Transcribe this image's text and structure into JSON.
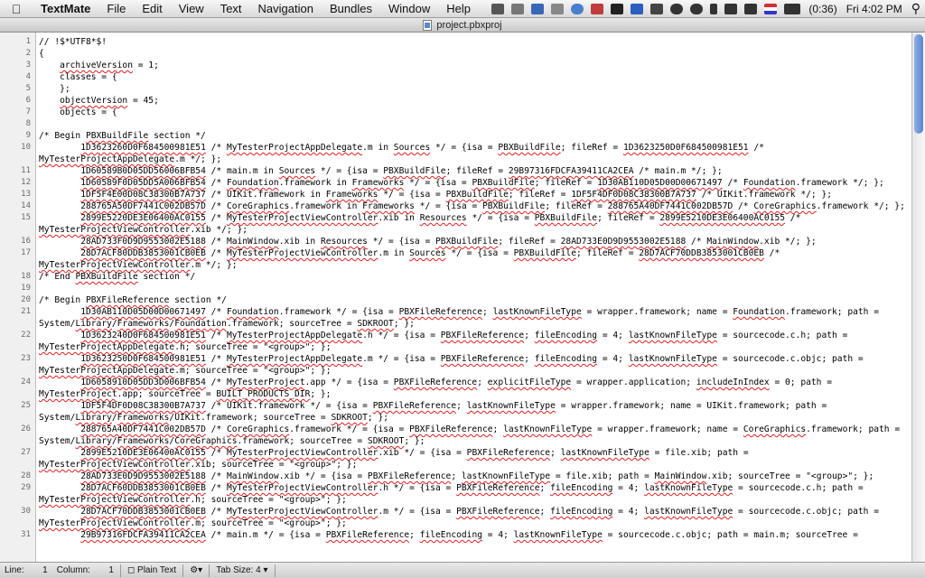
{
  "menubar": {
    "app": "TextMate",
    "items": [
      "File",
      "Edit",
      "View",
      "Text",
      "Navigation",
      "Bundles",
      "Window",
      "Help"
    ],
    "battery": "(0:36)",
    "clock": "Fri 4:02 PM"
  },
  "window": {
    "title": "project.pbxproj"
  },
  "status": {
    "line_label": "Line:",
    "line": "1",
    "column_label": "Column:",
    "column": "1",
    "language": "Plain Text",
    "tab_size_label": "Tab Size:",
    "tab_size": "4"
  },
  "line_numbers": [
    "1",
    "2",
    "3",
    "4",
    "5",
    "6",
    "7",
    "8",
    "9",
    "10",
    "11",
    "12",
    "13",
    "14",
    "15",
    "16",
    "17",
    "18",
    "19",
    "20",
    "21",
    "22",
    "23",
    "24",
    "25",
    "26",
    "27",
    "28",
    "29",
    "30",
    "31"
  ],
  "rows": [
    {
      "ln": "1",
      "t": "// !$*UTF8*$!"
    },
    {
      "ln": "2",
      "t": "{"
    },
    {
      "ln": "3",
      "t": "\tarchiveVersion = 1;"
    },
    {
      "ln": "4",
      "t": "\tclasses = {"
    },
    {
      "ln": "5",
      "t": "\t};"
    },
    {
      "ln": "6",
      "t": "\tobjectVersion = 45;"
    },
    {
      "ln": "7",
      "t": "\tobjects = {"
    },
    {
      "ln": "8",
      "t": ""
    },
    {
      "ln": "9",
      "t": "/* Begin PBXBuildFile section */"
    },
    {
      "ln": "10",
      "t": "\t\t1D3623260D0F684500981E51 /* MyTesterProjectAppDelegate.m in Sources */ = {isa = PBXBuildFile; fileRef = 1D3623250D0F684500981E51 /*"
    },
    {
      "ln": "",
      "t": "MyTesterProjectAppDelegate.m */; };"
    },
    {
      "ln": "11",
      "t": "\t\t1D60589B0D05DD56006BFB54 /* main.m in Sources */ = {isa = PBXBuildFile; fileRef = 29B97316FDCFA39411CA2CEA /* main.m */; };"
    },
    {
      "ln": "12",
      "t": "\t\t1D60589F0D05DD5A006BFB54 /* Foundation.framework in Frameworks */ = {isa = PBXBuildFile; fileRef = 1D30AB110D05D00D00671497 /* Foundation.framework */; };"
    },
    {
      "ln": "13",
      "t": "\t\t1DF5F4E00D08C38300B7A737 /* UIKit.framework in Frameworks */ = {isa = PBXBuildFile; fileRef = 1DF5F4DF0D08C38300B7A737 /* UIKit.framework */; };"
    },
    {
      "ln": "14",
      "t": "\t\t288765A50DF7441C002DB57D /* CoreGraphics.framework in Frameworks */ = {isa = PBXBuildFile; fileRef = 288765A40DF7441C002DB57D /* CoreGraphics.framework */; };"
    },
    {
      "ln": "15",
      "t": "\t\t2899E5220DE3E06400AC0155 /* MyTesterProjectViewController.xib in Resources */ = {isa = PBXBuildFile; fileRef = 2899E5210DE3E06400AC0155 /*"
    },
    {
      "ln": "",
      "t": "MyTesterProjectViewController.xib */; };"
    },
    {
      "ln": "16",
      "t": "\t\t28AD733F0D9D9553002E5188 /* MainWindow.xib in Resources */ = {isa = PBXBuildFile; fileRef = 28AD733E0D9D9553002E5188 /* MainWindow.xib */; };"
    },
    {
      "ln": "17",
      "t": "\t\t28D7ACF80DDB3853001CB0EB /* MyTesterProjectViewController.m in Sources */ = {isa = PBXBuildFile; fileRef = 28D7ACF70DDB3853001CB0EB /*"
    },
    {
      "ln": "",
      "t": "MyTesterProjectViewController.m */; };"
    },
    {
      "ln": "18",
      "t": "/* End PBXBuildFile section */"
    },
    {
      "ln": "19",
      "t": ""
    },
    {
      "ln": "20",
      "t": "/* Begin PBXFileReference section */"
    },
    {
      "ln": "21",
      "t": "\t\t1D30AB110D05D00D00671497 /* Foundation.framework */ = {isa = PBXFileReference; lastKnownFileType = wrapper.framework; name = Foundation.framework; path ="
    },
    {
      "ln": "",
      "t": "System/Library/Frameworks/Foundation.framework; sourceTree = SDKROOT; };"
    },
    {
      "ln": "22",
      "t": "\t\t1D3623240D0F684500981E51 /* MyTesterProjectAppDelegate.h */ = {isa = PBXFileReference; fileEncoding = 4; lastKnownFileType = sourcecode.c.h; path ="
    },
    {
      "ln": "",
      "t": "MyTesterProjectAppDelegate.h; sourceTree = \"<group>\"; };"
    },
    {
      "ln": "23",
      "t": "\t\t1D3623250D0F684500981E51 /* MyTesterProjectAppDelegate.m */ = {isa = PBXFileReference; fileEncoding = 4; lastKnownFileType = sourcecode.c.objc; path ="
    },
    {
      "ln": "",
      "t": "MyTesterProjectAppDelegate.m; sourceTree = \"<group>\"; };"
    },
    {
      "ln": "24",
      "t": "\t\t1D6058910D05DD3D006BFB54 /* MyTesterProject.app */ = {isa = PBXFileReference; explicitFileType = wrapper.application; includeInIndex = 0; path ="
    },
    {
      "ln": "",
      "t": "MyTesterProject.app; sourceTree = BUILT_PRODUCTS_DIR; };"
    },
    {
      "ln": "25",
      "t": "\t\t1DF5F4DF0D08C38300B7A737 /* UIKit.framework */ = {isa = PBXFileReference; lastKnownFileType = wrapper.framework; name = UIKit.framework; path ="
    },
    {
      "ln": "",
      "t": "System/Library/Frameworks/UIKit.framework; sourceTree = SDKROOT; };"
    },
    {
      "ln": "26",
      "t": "\t\t288765A40DF7441C002DB57D /* CoreGraphics.framework */ = {isa = PBXFileReference; lastKnownFileType = wrapper.framework; name = CoreGraphics.framework; path ="
    },
    {
      "ln": "",
      "t": "System/Library/Frameworks/CoreGraphics.framework; sourceTree = SDKROOT; };"
    },
    {
      "ln": "27",
      "t": "\t\t2899E5210DE3E06400AC0155 /* MyTesterProjectViewController.xib */ = {isa = PBXFileReference; lastKnownFileType = file.xib; path ="
    },
    {
      "ln": "",
      "t": "MyTesterProjectViewController.xib; sourceTree = \"<group>\"; };"
    },
    {
      "ln": "28",
      "t": "\t\t28AD733E0D9D9553002E5188 /* MainWindow.xib */ = {isa = PBXFileReference; lastKnownFileType = file.xib; path = MainWindow.xib; sourceTree = \"<group>\"; };"
    },
    {
      "ln": "29",
      "t": "\t\t28D7ACF60DDB3853001CB0EB /* MyTesterProjectViewController.h */ = {isa = PBXFileReference; fileEncoding = 4; lastKnownFileType = sourcecode.c.h; path ="
    },
    {
      "ln": "",
      "t": "MyTesterProjectViewController.h; sourceTree = \"<group>\"; };"
    },
    {
      "ln": "30",
      "t": "\t\t28D7ACF70DDB3853001CB0EB /* MyTesterProjectViewController.m */ = {isa = PBXFileReference; fileEncoding = 4; lastKnownFileType = sourcecode.c.objc; path ="
    },
    {
      "ln": "",
      "t": "MyTesterProjectViewController.m; sourceTree = \"<group>\"; };"
    },
    {
      "ln": "31",
      "t": "\t\t29B97316FDCFA39411CA2CEA /* main.m */ = {isa = PBXFileReference; fileEncoding = 4; lastKnownFileType = sourcecode.c.objc; path = main.m; sourceTree ="
    }
  ]
}
